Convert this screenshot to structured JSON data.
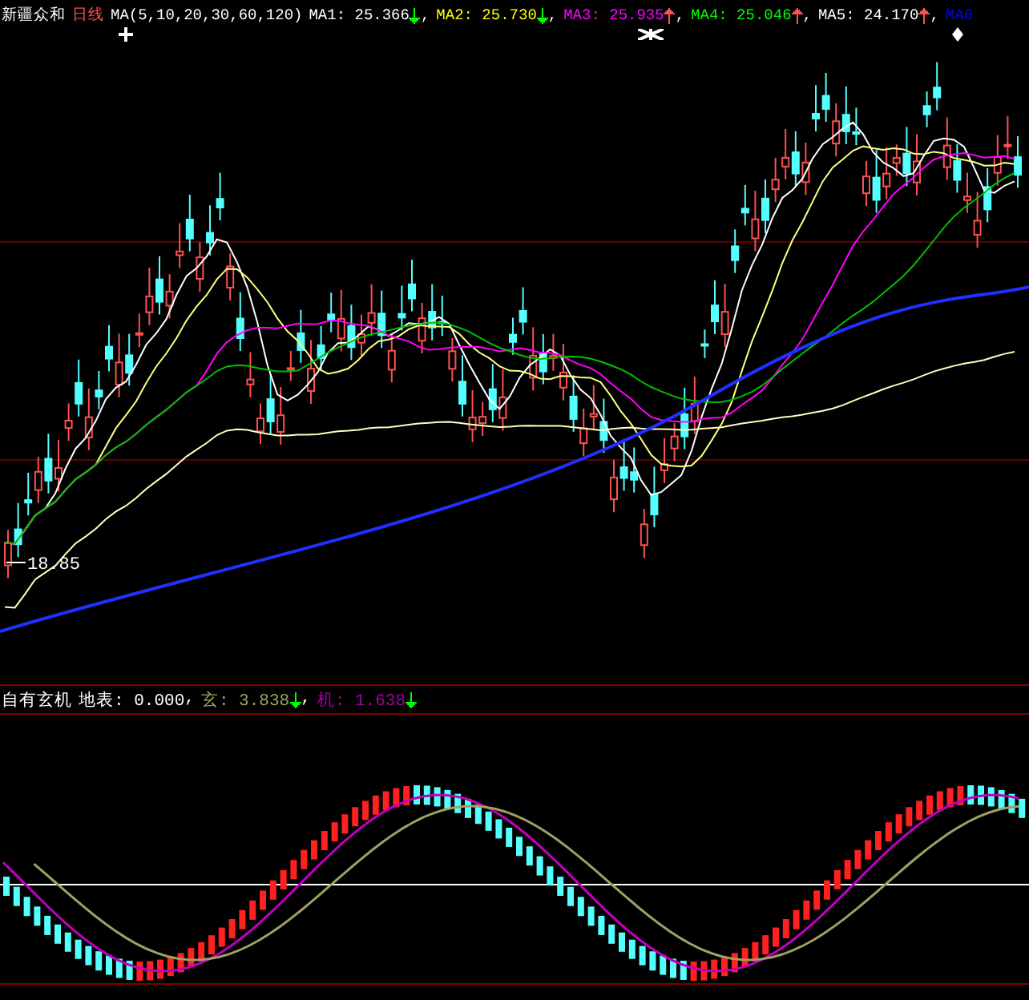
{
  "header": {
    "stock": "新疆众和",
    "period": "日线",
    "ma_params": "MA(5,10,20,30,60,120)",
    "averages": [
      {
        "name": "MA1:",
        "value": "25.366",
        "arrow": {
          "kind": "down",
          "color": "#00ff00"
        },
        "separator": ",",
        "color": "#ffffff"
      },
      {
        "name": "MA2:",
        "value": "25.730",
        "arrow": {
          "kind": "down",
          "color": "#00ff00"
        },
        "separator": ",",
        "color": "#ffff00"
      },
      {
        "name": "MA3:",
        "value": "25.935",
        "arrow": {
          "kind": "up",
          "color": "#ff5050"
        },
        "separator": ",",
        "color": "#ff00ff"
      },
      {
        "name": "MA4:",
        "value": "25.046",
        "arrow": {
          "kind": "up",
          "color": "#ff5050"
        },
        "separator": ",",
        "color": "#00ff00"
      },
      {
        "name": "MA5:",
        "value": "24.170",
        "arrow": {
          "kind": "up",
          "color": "#ff5050"
        },
        "separator": ",",
        "color": "#ffffff"
      },
      {
        "name": "MA6",
        "color": "#0000ff"
      }
    ]
  },
  "main_chart": {
    "low_label": "18.85"
  },
  "indicator": {
    "title": "自有玄机",
    "items": [
      {
        "name": "地表:",
        "value": "0.000",
        "separator": ",",
        "color": "#ffffff"
      },
      {
        "name": "玄:",
        "value": "3.838",
        "arrow": {
          "kind": "down",
          "color": "#00ff00"
        },
        "separator": ",",
        "color": "#a0a060"
      },
      {
        "name": "机:",
        "value": "1.638",
        "arrow": {
          "kind": "down",
          "color": "#00ff00"
        },
        "color": "#a000a0"
      }
    ]
  }
}
